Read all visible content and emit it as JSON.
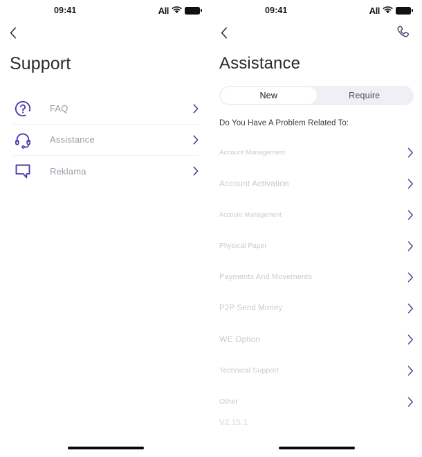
{
  "accent": "#4b3fb0",
  "status_bar": {
    "time": "09:41",
    "signal_label": "All",
    "wifi_icon": "wifi-icon",
    "battery_icon": "battery-icon"
  },
  "left_screen": {
    "back_icon": "chevron-left-icon",
    "title": "Support",
    "menu": [
      {
        "label": "FAQ",
        "icon": "question-circle-icon",
        "chevron": "chevron-right-icon"
      },
      {
        "label": "Assistance",
        "icon": "headset-icon",
        "chevron": "chevron-right-icon"
      },
      {
        "label": "Reklama",
        "icon": "speech-bubble-icon",
        "chevron": "chevron-right-icon"
      }
    ]
  },
  "right_screen": {
    "back_icon": "chevron-left-icon",
    "call_icon": "phone-icon",
    "title": "Assistance",
    "tabs": [
      {
        "label": "New",
        "active": true
      },
      {
        "label": "Require",
        "active": false
      }
    ],
    "prompt": "Do You Have A Problem Related To:",
    "topics": [
      {
        "label": "Account Management",
        "size": 9.5
      },
      {
        "label": "Account Activation",
        "size": 12
      },
      {
        "label": "Account Management",
        "size": 9
      },
      {
        "label": "Physical Paper",
        "size": 10
      },
      {
        "label": "Payments And Movements",
        "size": 11
      },
      {
        "label": "P2P Send Money",
        "size": 11.5
      },
      {
        "label": "WE Option",
        "size": 12
      },
      {
        "label": "Technical Support",
        "size": 10.5
      },
      {
        "label": "Other",
        "size": 10.5
      }
    ],
    "version": "V2.15.1"
  }
}
